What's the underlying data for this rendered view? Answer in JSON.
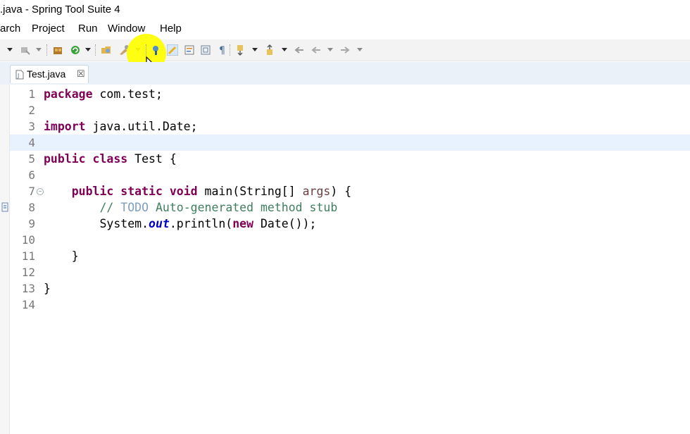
{
  "window": {
    "title": ".java - Spring Tool Suite 4"
  },
  "menubar": {
    "items": [
      {
        "label": "arch"
      },
      {
        "label": "Project"
      },
      {
        "label": "Run"
      },
      {
        "label": "Window"
      },
      {
        "label": "Help"
      }
    ]
  },
  "toolbar": {
    "icons": [
      "debug-arrow-icon",
      "skip-breakpoints-icon",
      "new-spring-starter-icon",
      "refresh-icon",
      "open-type-icon",
      "open-task-icon",
      "search-icon",
      "toggle-mark-occurrences-icon",
      "toggle-word-wrap-icon",
      "block-selection-icon",
      "show-whitespace-icon",
      "next-annotation-icon",
      "previous-annotation-icon",
      "last-edit-location-icon",
      "back-icon",
      "forward-icon"
    ]
  },
  "editor": {
    "tab": {
      "label": "Test.java",
      "close": "☒"
    },
    "current_line": 4,
    "lines": [
      {
        "number": "1",
        "parts": [
          {
            "t": "package",
            "c": "kw"
          },
          {
            "t": " com.test;",
            "c": ""
          }
        ]
      },
      {
        "number": "2",
        "parts": []
      },
      {
        "number": "3",
        "parts": [
          {
            "t": "import",
            "c": "kw"
          },
          {
            "t": " java.util.Date;",
            "c": ""
          }
        ]
      },
      {
        "number": "4",
        "parts": []
      },
      {
        "number": "5",
        "parts": [
          {
            "t": "public",
            "c": "kw"
          },
          {
            "t": " ",
            "c": ""
          },
          {
            "t": "class",
            "c": "kw"
          },
          {
            "t": " Test {",
            "c": ""
          }
        ]
      },
      {
        "number": "6",
        "parts": []
      },
      {
        "number": "7",
        "parts": [
          {
            "t": "    ",
            "c": ""
          },
          {
            "t": "public",
            "c": "kw"
          },
          {
            "t": " ",
            "c": ""
          },
          {
            "t": "static",
            "c": "kw"
          },
          {
            "t": " ",
            "c": ""
          },
          {
            "t": "void",
            "c": "kw"
          },
          {
            "t": " main(String[] ",
            "c": ""
          },
          {
            "t": "args",
            "c": "param"
          },
          {
            "t": ") {",
            "c": ""
          }
        ]
      },
      {
        "number": "8",
        "parts": [
          {
            "t": "        ",
            "c": ""
          },
          {
            "t": "// ",
            "c": "cm"
          },
          {
            "t": "TODO",
            "c": "todo"
          },
          {
            "t": " Auto-generated method stub",
            "c": "cm"
          }
        ]
      },
      {
        "number": "9",
        "parts": [
          {
            "t": "        System.",
            "c": ""
          },
          {
            "t": "out",
            "c": "field"
          },
          {
            "t": ".println(",
            "c": ""
          },
          {
            "t": "new",
            "c": "kw"
          },
          {
            "t": " Date());",
            "c": ""
          }
        ]
      },
      {
        "number": "10",
        "parts": []
      },
      {
        "number": "11",
        "parts": [
          {
            "t": "    }",
            "c": ""
          }
        ]
      },
      {
        "number": "12",
        "parts": []
      },
      {
        "number": "13",
        "parts": [
          {
            "t": "}",
            "c": ""
          }
        ]
      },
      {
        "number": "14",
        "parts": []
      }
    ]
  },
  "colors": {
    "keyword": "#7f0055",
    "comment": "#3f7f5f",
    "todo": "#7f9fbf",
    "static_field": "#0000c0",
    "current_line": "#e8f2fe",
    "click_highlight": "#ffff00"
  }
}
